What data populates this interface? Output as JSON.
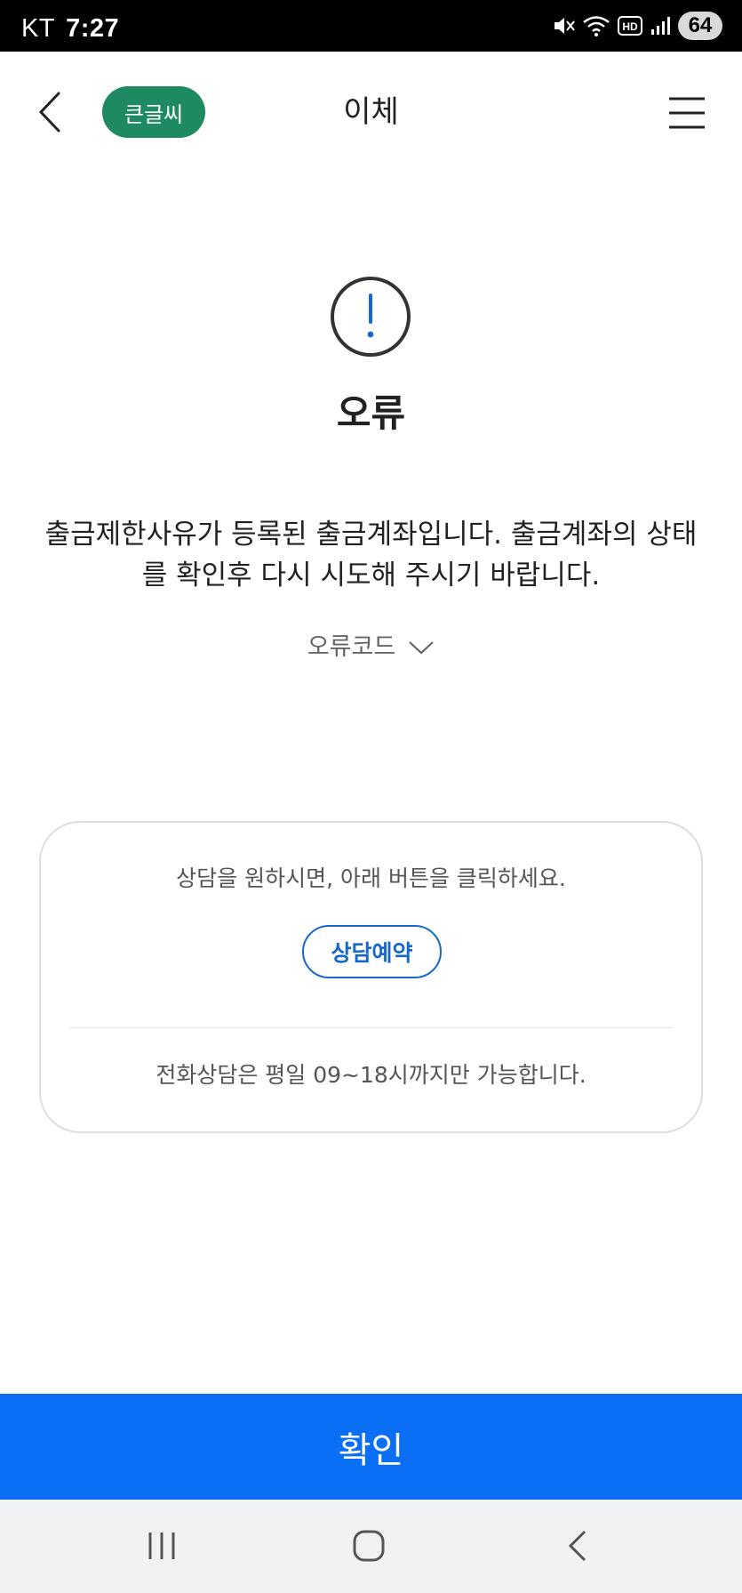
{
  "status_bar": {
    "carrier": "KT",
    "time": "7:27",
    "battery": "64",
    "icons": [
      "mute-icon",
      "wifi-icon",
      "hd-icon",
      "signal-icon",
      "battery-icon"
    ]
  },
  "header": {
    "back_icon": "chevron-left-icon",
    "big_font_label": "큰글씨",
    "title": "이체",
    "menu_icon": "hamburger-menu-icon"
  },
  "error": {
    "icon": "exclamation-circle-icon",
    "title": "오류",
    "message_line1": "출금제한사유가 등록된 출금계좌입니다. 출금계좌의 상태",
    "message_line2": "를 확인후 다시 시도해 주시기 바랍니다.",
    "code_toggle_label": "오류코드",
    "code_toggle_icon": "chevron-down-icon"
  },
  "consult": {
    "guide_text": "상담을 원하시면, 아래 버튼을 클릭하세요.",
    "reserve_button_label": "상담예약",
    "hours_text": "전화상담은 평일 09~18시까지만 가능합니다."
  },
  "footer": {
    "confirm_label": "확인"
  },
  "nav_bar": {
    "icons": [
      "recent-apps-icon",
      "home-icon",
      "back-icon"
    ]
  },
  "colors": {
    "accent_green": "#1e8a62",
    "primary_blue": "#0b6ff5",
    "link_blue": "#1769c9",
    "exclamation_blue": "#1769c9"
  }
}
